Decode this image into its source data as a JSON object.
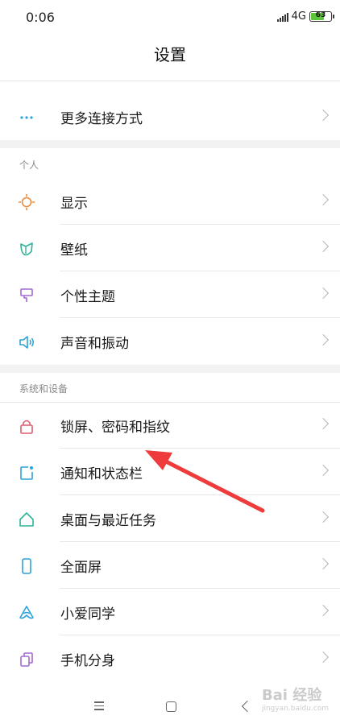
{
  "status": {
    "time": "0:06",
    "network": "4G",
    "battery": "63"
  },
  "header": {
    "title": "设置"
  },
  "rows": {
    "more_connections": "更多连接方式",
    "display": "显示",
    "wallpaper": "壁纸",
    "theme": "个性主题",
    "sound": "声音和振动",
    "lock": "锁屏、密码和指纹",
    "notify": "通知和状态栏",
    "desktop": "桌面与最近任务",
    "fullscreen": "全面屏",
    "xiaoai": "小爱同学",
    "dual": "手机分身"
  },
  "sections": {
    "personal": "个人",
    "system": "系统和设备"
  },
  "colors": {
    "accent_blue": "#2aa3d8",
    "orange": "#f08a3a",
    "teal": "#2fb39a",
    "purple": "#a06ad3",
    "lock_red": "#e05c6d",
    "arrow_red": "#ee3b3b"
  },
  "watermark": {
    "brand": "Bai 经验",
    "sub": "jingyan.baidu.com"
  }
}
